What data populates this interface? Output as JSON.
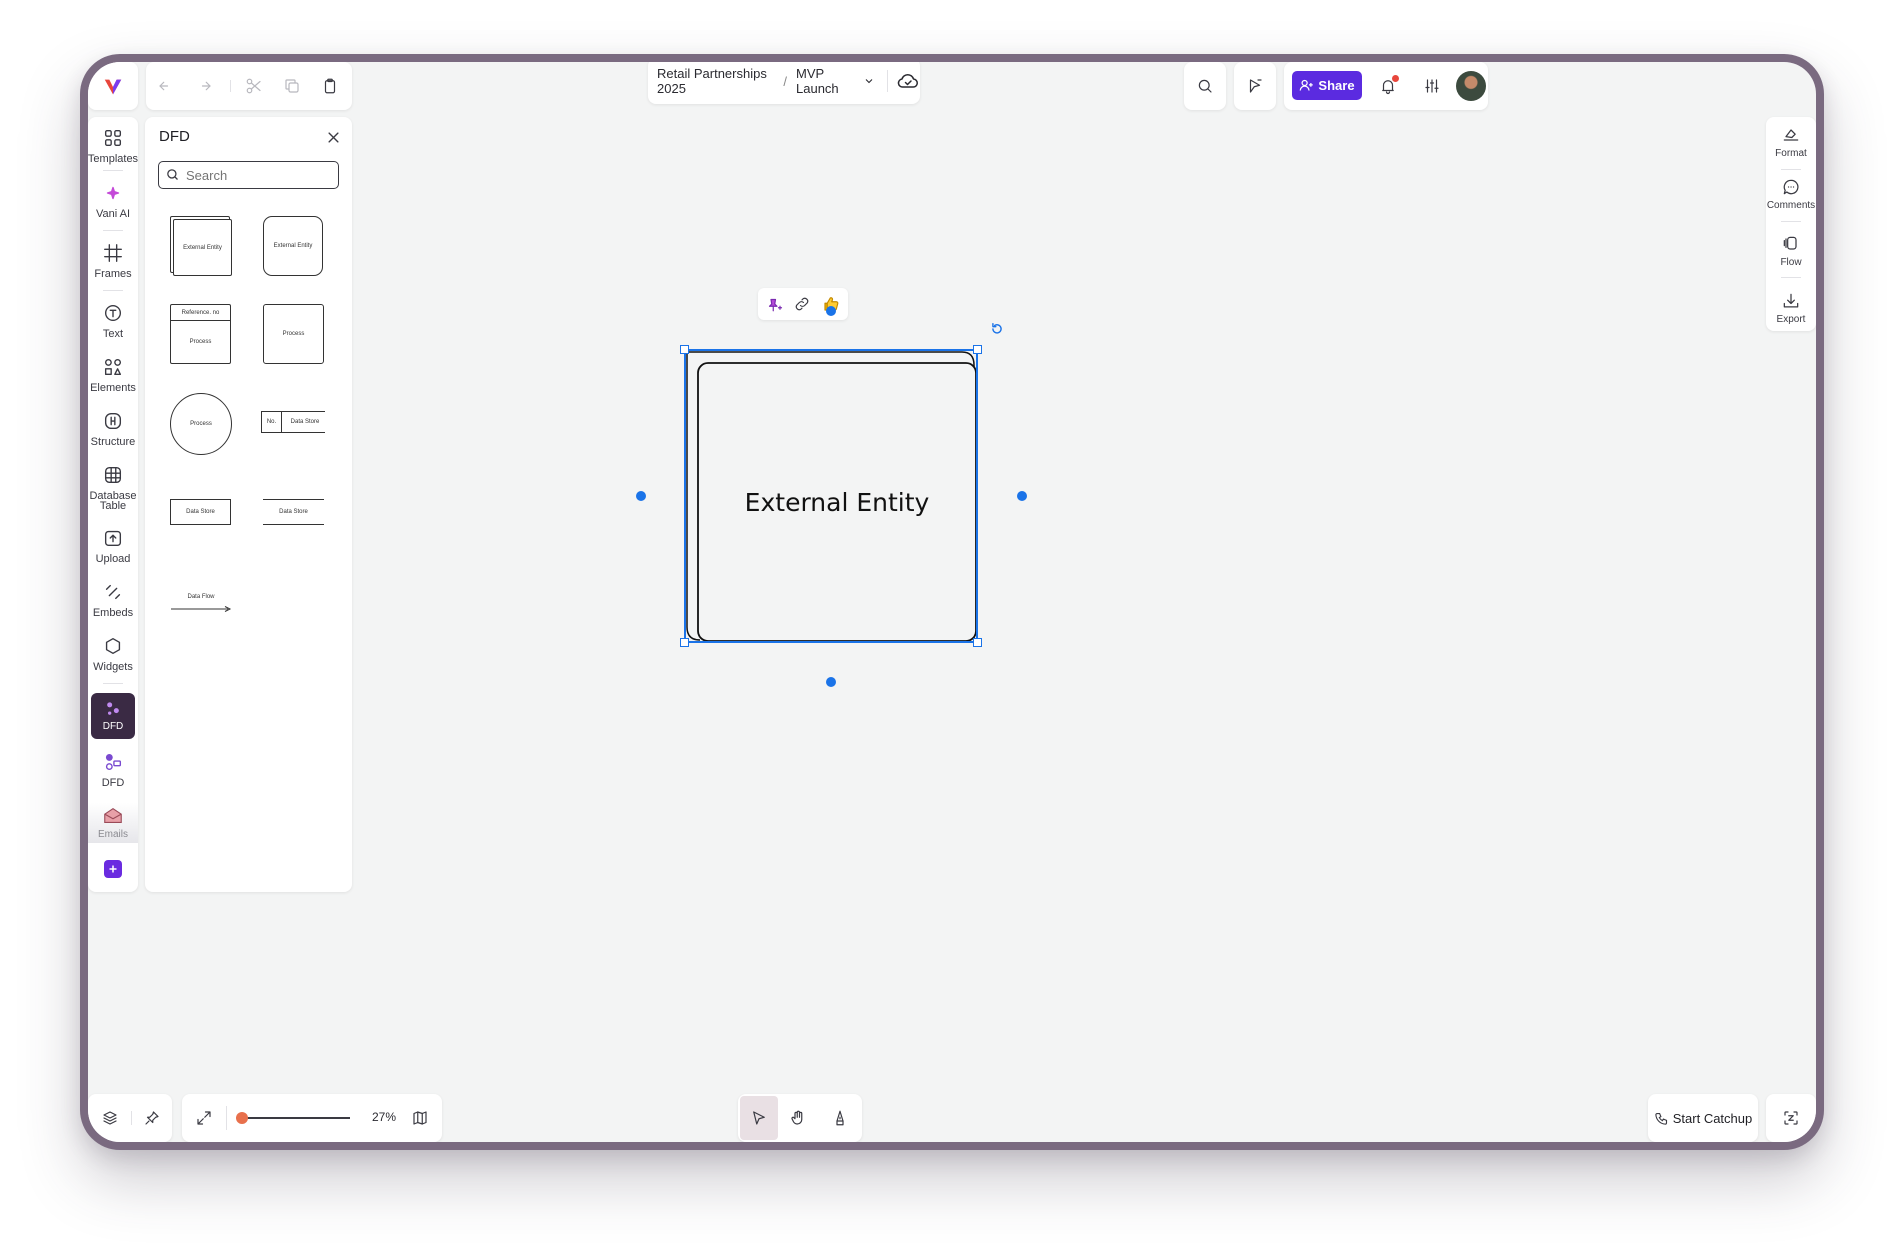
{
  "header": {
    "breadcrumb_project": "Retail Partnerships 2025",
    "breadcrumb_separator": "/",
    "breadcrumb_board": "MVP Launch",
    "share_label": "Share"
  },
  "left_toolbar": {
    "items": [
      {
        "label": "Templates",
        "icon": "templates-icon"
      },
      {
        "label": "Vani AI",
        "icon": "sparkle-icon"
      },
      {
        "label": "Frames",
        "icon": "frame-icon"
      },
      {
        "label": "Text",
        "icon": "text-icon"
      },
      {
        "label": "Elements",
        "icon": "elements-icon"
      },
      {
        "label": "Structure",
        "icon": "structure-icon"
      },
      {
        "label": "Database Table",
        "icon": "database-table-icon"
      },
      {
        "label": "Upload",
        "icon": "upload-icon"
      },
      {
        "label": "Embeds",
        "icon": "embed-icon"
      },
      {
        "label": "Widgets",
        "icon": "widget-icon"
      },
      {
        "label": "DFD",
        "icon": "dfd-icon",
        "active": true
      },
      {
        "label": "DFD",
        "icon": "dfd-icon"
      },
      {
        "label": "Emails",
        "icon": "email-icon"
      }
    ]
  },
  "shape_panel": {
    "title": "DFD",
    "search_placeholder": "Search",
    "shapes": {
      "external_entity_stacked": "External Entity",
      "external_entity_rounded": "External Entity",
      "process_ref_header": "Reference. no",
      "process_ref_body": "Process",
      "process_rect": "Process",
      "process_circle": "Process",
      "data_store_no": "No.",
      "data_store_open_label": "Data Store",
      "data_store_box": "Data Store",
      "data_store_lines": "Data Store",
      "data_flow": "Data Flow"
    }
  },
  "canvas": {
    "selected_shape_label": "External Entity",
    "accent_color": "#1a73e8"
  },
  "right_toolbar": {
    "items": [
      {
        "label": "Format",
        "icon": "format-icon"
      },
      {
        "label": "Comments",
        "icon": "comment-icon"
      },
      {
        "label": "Flow",
        "icon": "flow-icon"
      },
      {
        "label": "Export",
        "icon": "export-icon"
      }
    ]
  },
  "bottom_bar": {
    "zoom_level": "27%",
    "start_catchup_label": "Start Catchup"
  },
  "colors": {
    "brand": "#5b2be0",
    "active_tool_bg": "#3a2a44",
    "selection": "#1a73e8"
  }
}
